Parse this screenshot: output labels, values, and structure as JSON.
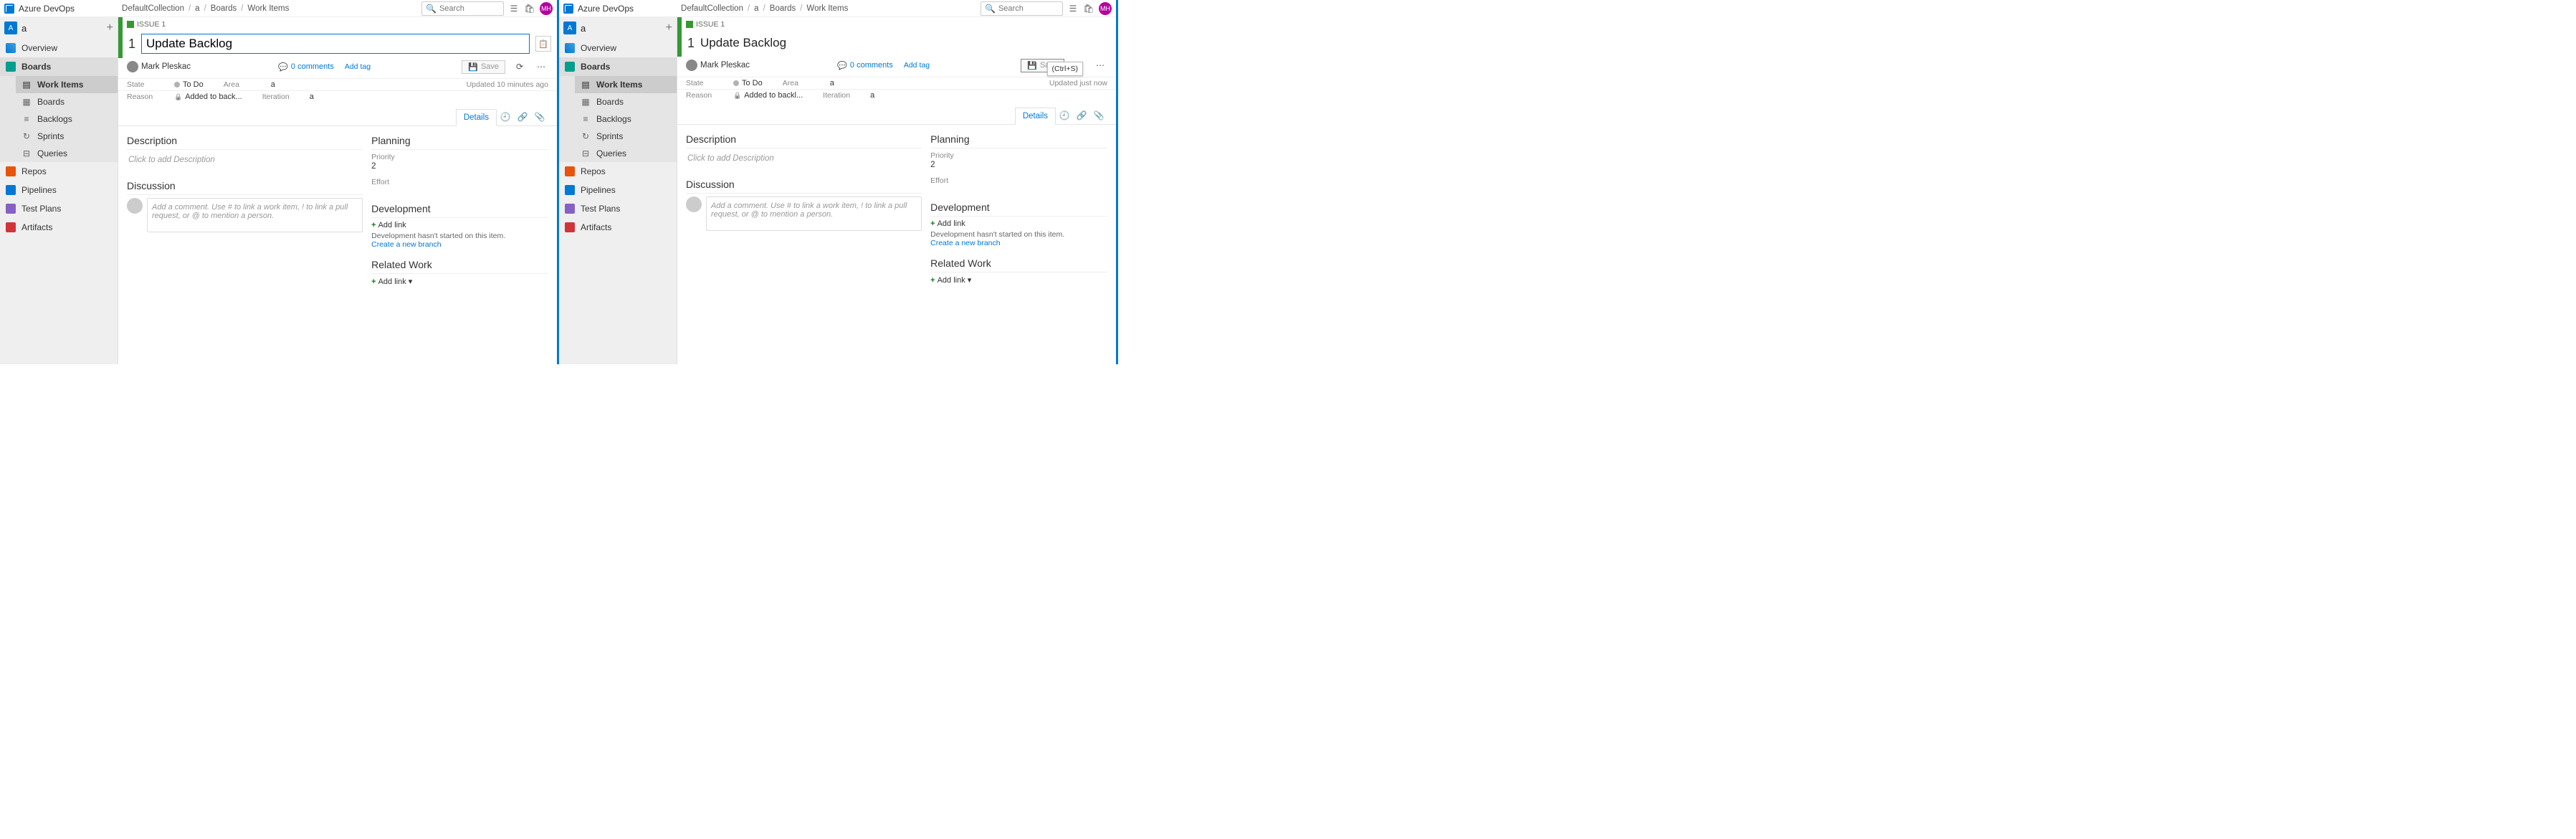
{
  "brand": "Azure DevOps",
  "breadcrumbs": [
    "DefaultCollection",
    "a",
    "Boards",
    "Work Items"
  ],
  "search_placeholder": "Search",
  "avatar_initials": "MH",
  "project": {
    "badge": "A",
    "name": "a"
  },
  "nav": {
    "overview": "Overview",
    "boards": "Boards",
    "sub": {
      "workitems": "Work Items",
      "boards": "Boards",
      "backlogs": "Backlogs",
      "sprints": "Sprints",
      "queries": "Queries"
    },
    "repos": "Repos",
    "pipelines": "Pipelines",
    "testplans": "Test Plans",
    "artifacts": "Artifacts"
  },
  "workitem": {
    "type_label": "ISSUE 1",
    "id": "1",
    "title": "Update Backlog",
    "assignee": "Mark Pleskac",
    "comments_label": "0 comments",
    "add_tag": "Add tag",
    "save": "Save",
    "save_tooltip": "(Ctrl+S)",
    "state_lbl": "State",
    "state_val": "To Do",
    "area_lbl": "Area",
    "area_val": "a",
    "reason_lbl": "Reason",
    "reason_val_left": "Added to back...",
    "reason_val_right": "Added to backl...",
    "iteration_lbl": "Iteration",
    "iteration_val": "a",
    "updated_left": "Updated 10 minutes ago",
    "updated_right": "Updated just now"
  },
  "tabs": {
    "details": "Details"
  },
  "sections": {
    "description": "Description",
    "desc_placeholder": "Click to add Description",
    "discussion": "Discussion",
    "disc_placeholder": "Add a comment. Use # to link a work item, ! to link a pull request, or @ to mention a person.",
    "planning": "Planning",
    "priority_lbl": "Priority",
    "priority_val": "2",
    "effort_lbl": "Effort",
    "development": "Development",
    "add_link": "Add link",
    "dev_note": "Development hasn't started on this item.",
    "create_branch": "Create a new branch",
    "related": "Related Work",
    "add_link_caret": "Add link ▾"
  }
}
